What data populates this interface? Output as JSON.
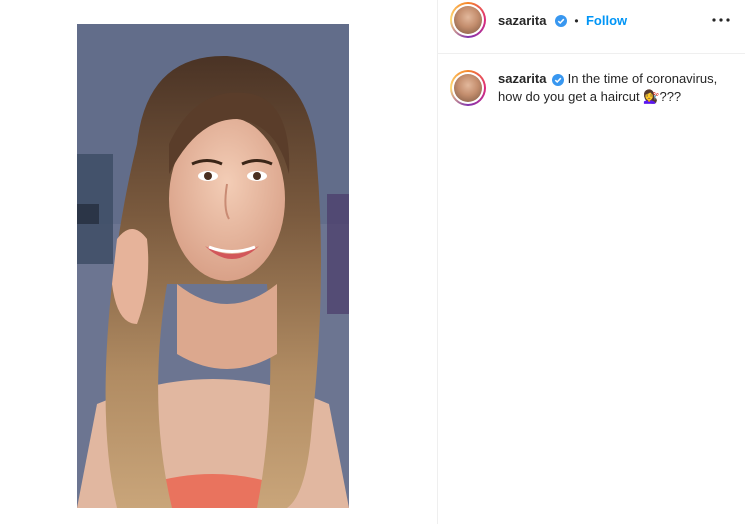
{
  "post": {
    "username": "sazarita",
    "follow_label": "Follow",
    "separator": "•",
    "caption_text": "In the time of coronavirus, how do you get a haircut",
    "caption_emoji": "💇‍♀️",
    "caption_suffix": "???"
  },
  "colors": {
    "follow": "#0095f6",
    "verified": "#3897f0",
    "divider": "#efefef"
  },
  "icons": {
    "verified": "verified-badge-icon",
    "more": "more-options-icon"
  }
}
